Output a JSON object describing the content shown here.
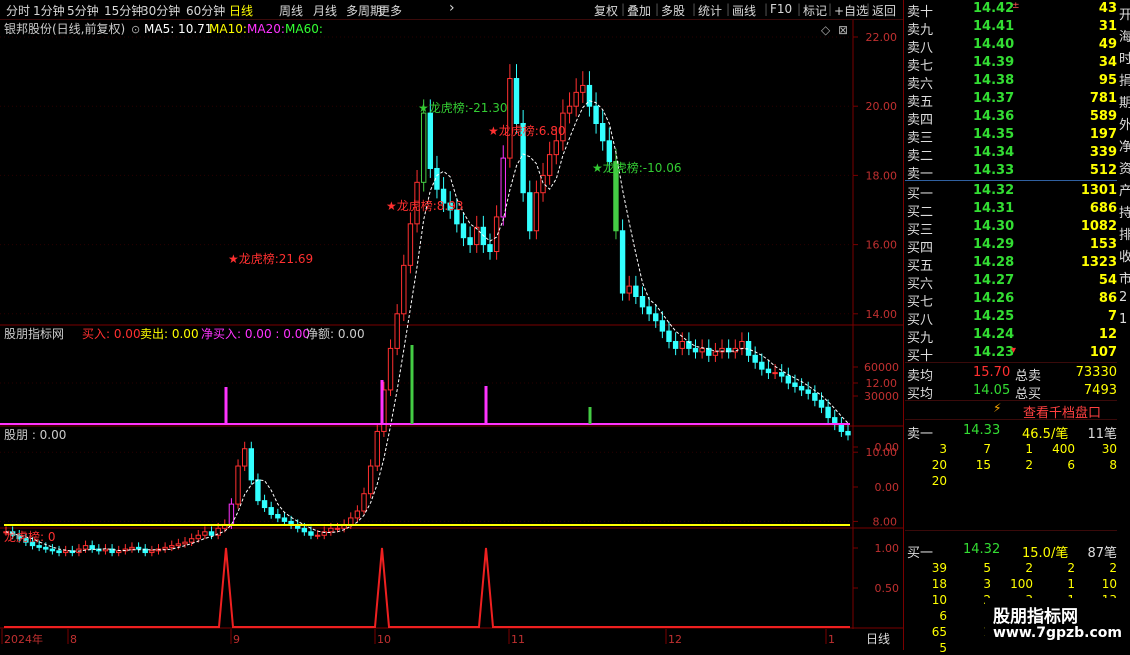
{
  "toolbar": {
    "periods": [
      "分时",
      "1分钟",
      "5分钟",
      "15分钟",
      "30分钟",
      "60分钟",
      "日线",
      "周线",
      "月线",
      "多周期",
      "更多"
    ],
    "active_period": "日线",
    "tools": [
      "复权",
      "叠加",
      "多股",
      "统计",
      "画线",
      "F10",
      "标记",
      "+自选",
      "返回"
    ]
  },
  "main_chart": {
    "stock_title": "银邦股份(日线,前复权)",
    "ma5_label": "MA5: 10.71",
    "ma10_label": "MA10:",
    "ma20_label": "MA20:",
    "ma60_label": "MA60:",
    "price_ticks": [
      "22.00",
      "20.00",
      "18.00",
      "16.00",
      "14.00",
      "12.00",
      "10.00",
      "8.00"
    ],
    "annotations": [
      {
        "text": "龙虎榜:21.69",
        "color": "#ff3030"
      },
      {
        "text": "龙虎榜:8.93",
        "color": "#ff3030"
      },
      {
        "text": "龙虎榜:-21.30",
        "color": "#33cc33"
      },
      {
        "text": "龙虎榜:6.80",
        "color": "#ff3030"
      },
      {
        "text": "龙虎榜:-10.06",
        "color": "#33cc33"
      }
    ]
  },
  "indicator1": {
    "name": "股朋指标网",
    "buy_label": "买入: 0.00",
    "sell_label": "卖出: 0.00",
    "netbuy_label": "净买入: 0.00 : 0.00",
    "netamt_label": "净额: 0.00",
    "ticks": [
      "60000",
      "30000"
    ]
  },
  "indicator2": {
    "name": "股朋 : 0.00",
    "ticks": [
      "0.00",
      "0.00"
    ]
  },
  "indicator3": {
    "name": "龙虎榜: 0",
    "ticks": [
      "1.00",
      "0.50"
    ]
  },
  "date_axis": {
    "labels": [
      "2024年",
      "8",
      "9",
      "10",
      "11",
      "12",
      "1"
    ],
    "period_button": "日线"
  },
  "order_book": {
    "asks": [
      {
        "label": "卖十",
        "price": "14.42",
        "vol": "43"
      },
      {
        "label": "卖九",
        "price": "14.41",
        "vol": "31"
      },
      {
        "label": "卖八",
        "price": "14.40",
        "vol": "49"
      },
      {
        "label": "卖七",
        "price": "14.39",
        "vol": "34"
      },
      {
        "label": "卖六",
        "price": "14.38",
        "vol": "95"
      },
      {
        "label": "卖五",
        "price": "14.37",
        "vol": "781"
      },
      {
        "label": "卖四",
        "price": "14.36",
        "vol": "589"
      },
      {
        "label": "卖三",
        "price": "14.35",
        "vol": "197"
      },
      {
        "label": "卖二",
        "price": "14.34",
        "vol": "339"
      },
      {
        "label": "卖一",
        "price": "14.33",
        "vol": "512"
      }
    ],
    "bids": [
      {
        "label": "买一",
        "price": "14.32",
        "vol": "1301"
      },
      {
        "label": "买二",
        "price": "14.31",
        "vol": "686"
      },
      {
        "label": "买三",
        "price": "14.30",
        "vol": "1082"
      },
      {
        "label": "买四",
        "price": "14.29",
        "vol": "153"
      },
      {
        "label": "买五",
        "price": "14.28",
        "vol": "1323"
      },
      {
        "label": "买六",
        "price": "14.27",
        "vol": "54"
      },
      {
        "label": "买七",
        "price": "14.26",
        "vol": "86"
      },
      {
        "label": "买八",
        "price": "14.25",
        "vol": "7"
      },
      {
        "label": "买九",
        "price": "14.24",
        "vol": "12"
      },
      {
        "label": "买十",
        "price": "14.23",
        "vol": "107"
      }
    ],
    "sell_avg_label": "卖均",
    "sell_avg": "15.70",
    "total_sell_label": "总卖",
    "total_sell": "73330",
    "buy_avg_label": "买均",
    "buy_avg": "14.05",
    "total_buy_label": "总买",
    "total_buy": "7493",
    "depth_button": "查看千档盘口"
  },
  "queue_sell": {
    "label": "卖一",
    "price": "14.33",
    "avg": "46.5/笔",
    "count": "11笔",
    "rows": [
      [
        "3",
        "7",
        "1",
        "400",
        "30"
      ],
      [
        "20",
        "15",
        "2",
        "6",
        "8"
      ],
      [
        "20",
        "",
        "",
        "",
        ""
      ]
    ]
  },
  "queue_buy": {
    "label": "买一",
    "price": "14.32",
    "avg": "15.0/笔",
    "count": "87笔",
    "rows": [
      [
        "39",
        "5",
        "2",
        "2",
        "2"
      ],
      [
        "18",
        "3",
        "100",
        "1",
        "10"
      ],
      [
        "10",
        "2",
        "3",
        "1",
        "13"
      ],
      [
        "6",
        "",
        "",
        "",
        ""
      ],
      [
        "65",
        "1",
        "",
        "",
        ""
      ],
      [
        "5",
        "",
        "",
        "",
        ""
      ]
    ]
  },
  "edge_chars": [
    "开",
    "海",
    "时",
    "捐",
    "期",
    "外",
    "净",
    "资",
    "产",
    "持",
    "排",
    "收",
    "市",
    "2",
    "1"
  ],
  "watermark": {
    "title": "股朋指标网",
    "url": "www.7gpzb.com"
  },
  "colors": {
    "up": "#ff3030",
    "down": "#33ffff",
    "green": "#33cc33",
    "magenta": "#ff33ff",
    "yellow": "#ffff00",
    "grid": "#7a0000"
  }
}
